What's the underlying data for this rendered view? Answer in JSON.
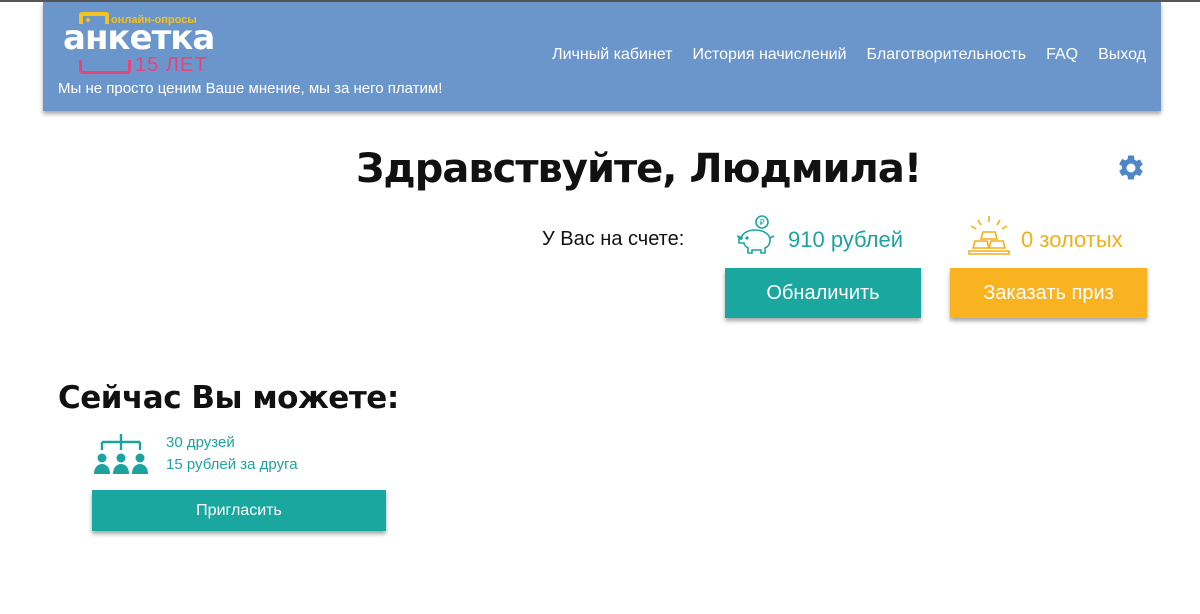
{
  "header": {
    "logo_small": "онлайн-опросы",
    "logo_brand": "анкетка",
    "logo_years": "15 ЛЕТ",
    "slogan": "Мы не просто ценим Ваше мнение, мы за него платим!",
    "nav": [
      {
        "label": "Личный кабинет"
      },
      {
        "label": "История начислений"
      },
      {
        "label": "Благотворительность"
      },
      {
        "label": "FAQ"
      },
      {
        "label": "Выход"
      }
    ]
  },
  "main": {
    "greeting": "Здравствуйте, Людмила!",
    "balance_label": "У Вас на счете:",
    "rubles": "910 рублей",
    "gold": "0 золотых",
    "cash_button": "Обналичить",
    "prize_button": "Заказать приз"
  },
  "offers": {
    "title": "Сейчас Вы можете:",
    "friends_count": "30 друзей",
    "friends_rate": "15 рублей за друга",
    "invite_button": "Пригласить"
  },
  "icons": {
    "settings": "gear-icon",
    "rubles": "piggy-bank-icon",
    "gold": "gold-bars-icon",
    "friends": "referral-tree-icon"
  },
  "colors": {
    "header_bg": "#6b96cc",
    "accent_teal": "#1aa79f",
    "accent_orange": "#f9b220",
    "logo_yellow": "#f4c21c",
    "logo_pink": "#e8447c",
    "gear": "#4f86c6"
  }
}
